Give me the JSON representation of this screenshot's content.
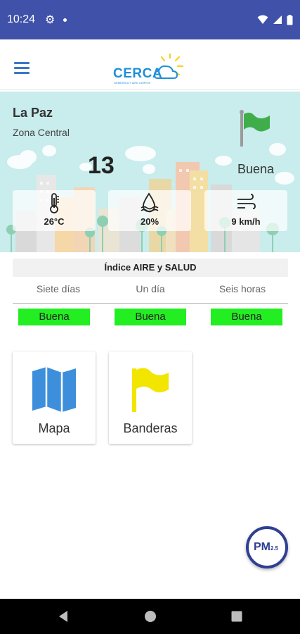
{
  "status_bar": {
    "time": "10:24",
    "icons": [
      "gear-icon",
      "dot-icon",
      "wifi-icon",
      "signal-icon",
      "battery-icon"
    ]
  },
  "app_bar": {
    "logo_text": "CERCA",
    "logo_subtext": "GEMERICA Y AIRE LIMPIOS",
    "menu_icon": "hamburger-menu-icon"
  },
  "hero": {
    "city": "La Paz",
    "zone": "Zona Central",
    "aqi_value": "13",
    "aqi_status": "Buena",
    "flag_color": "#3fae4a",
    "weather": {
      "temperature": "26°C",
      "humidity": "20%",
      "wind": "9 km/h"
    }
  },
  "index": {
    "title": "Índice AIRE y SALUD",
    "periods": [
      {
        "label": "Siete días",
        "status": "Buena"
      },
      {
        "label": "Un día",
        "status": "Buena"
      },
      {
        "label": "Seis horas",
        "status": "Buena"
      }
    ],
    "status_color": "#22ee22"
  },
  "tiles": [
    {
      "label": "Mapa",
      "icon": "map-icon"
    },
    {
      "label": "Banderas",
      "icon": "flag-icon"
    }
  ],
  "fab": {
    "label": "PM",
    "sub": "2.5"
  },
  "colors": {
    "primary": "#3f51a8",
    "accent": "#1f8fd8",
    "good": "#22ee22"
  }
}
